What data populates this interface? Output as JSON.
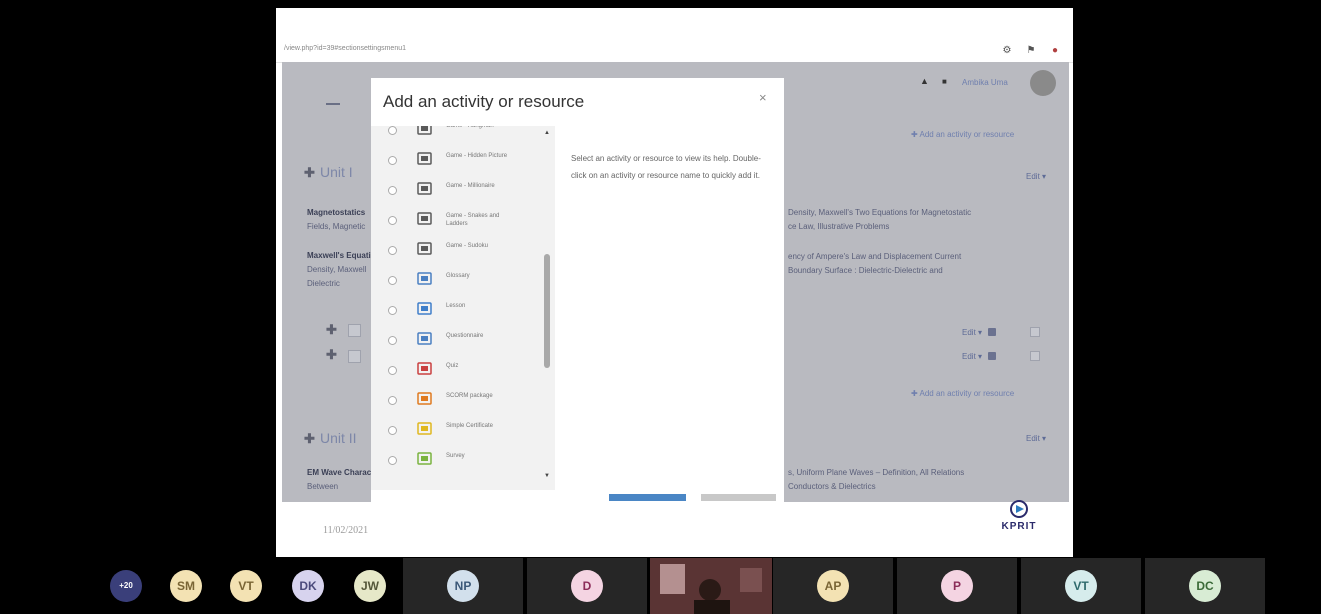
{
  "browser": {
    "url": "/view.php?id=39#sectionsettingsmenu1"
  },
  "course_page": {
    "user_name": "Ambika Uma",
    "add_activity_label": "Add an activity or resource",
    "unit1_title": "Unit I",
    "unit2_title": "Unit II",
    "edit_label": "Edit",
    "magneto_title": "Magnetostatics",
    "magneto_fields": "Fields, Magnetic",
    "magneto_right": "Density, Maxwell's Two Equations for Magnetostatic",
    "magneto_right2": "ce Law, Illustrative Problems",
    "maxwell_title": "Maxwell's Equations",
    "maxwell_line1": "Density, Maxwell",
    "maxwell_line2": "Dielectric",
    "maxwell_right1": "ency of Ampere's Law and Displacement Current",
    "maxwell_right2": "Boundary Surface : Dielectric-Dielectric and",
    "em_title": "EM Wave Characteristics",
    "em_line1": "Between",
    "em_right1": "s, Uniform Plane Waves – Definition, All Relations",
    "em_right2": "Conductors & Dielectrics"
  },
  "modal": {
    "title": "Add an activity or resource",
    "close": "×",
    "help_text": "Select an activity or resource to view its help. Double-click on an activity or resource name to quickly add it.",
    "items": [
      {
        "label": "Game - Hangman",
        "icon": "game-icon",
        "color": "#5a5a5a"
      },
      {
        "label": "Game - Hidden Picture",
        "icon": "game-icon",
        "color": "#5a5a5a"
      },
      {
        "label": "Game - Millionaire",
        "icon": "game-icon",
        "color": "#5a5a5a"
      },
      {
        "label": "Game - Snakes and Ladders",
        "icon": "game-icon",
        "color": "#5a5a5a"
      },
      {
        "label": "Game - Sudoku",
        "icon": "game-icon",
        "color": "#5a5a5a"
      },
      {
        "label": "Glossary",
        "icon": "glossary-icon",
        "color": "#4a7fc1"
      },
      {
        "label": "Lesson",
        "icon": "lesson-icon",
        "color": "#3f7ec9"
      },
      {
        "label": "Questionnaire",
        "icon": "questionnaire-icon",
        "color": "#4a7fc1"
      },
      {
        "label": "Quiz",
        "icon": "quiz-icon",
        "color": "#c94040"
      },
      {
        "label": "SCORM package",
        "icon": "scorm-icon",
        "color": "#e07a1f"
      },
      {
        "label": "Simple Certificate",
        "icon": "certificate-icon",
        "color": "#e0b81f"
      },
      {
        "label": "Survey",
        "icon": "survey-icon",
        "color": "#7ab33f"
      }
    ]
  },
  "slide": {
    "date": "11/02/2021",
    "logo": "KPRIT"
  },
  "participants": {
    "overflow": "+20",
    "bubbles": [
      {
        "initials": "SM",
        "bg": "#f3e2b3",
        "fg": "#7a6535"
      },
      {
        "initials": "VT",
        "bg": "#f3e2b3",
        "fg": "#7a6535"
      },
      {
        "initials": "DK",
        "bg": "#d7d3ee",
        "fg": "#4b4a7c"
      },
      {
        "initials": "JW",
        "bg": "#e6e8c8",
        "fg": "#55573a"
      }
    ],
    "tiles": [
      {
        "initials": "NP",
        "bg": "#d2e0ec",
        "fg": "#3b5878"
      },
      {
        "initials": "D",
        "bg": "#f4d4e2",
        "fg": "#8c2c59"
      },
      {
        "initials": "AP",
        "bg": "#f3e2b3",
        "fg": "#7a6535"
      },
      {
        "initials": "P",
        "bg": "#f4d4e2",
        "fg": "#8c2c59"
      },
      {
        "initials": "VT",
        "bg": "#d6ecec",
        "fg": "#2f6a6c"
      },
      {
        "initials": "DC",
        "bg": "#d8ecd4",
        "fg": "#3b6a38"
      }
    ]
  }
}
